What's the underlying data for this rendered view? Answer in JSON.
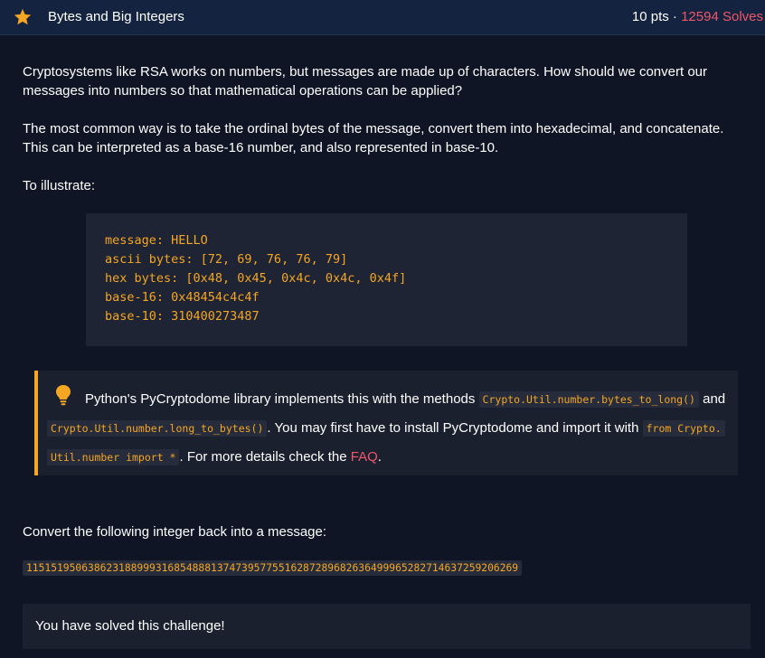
{
  "header": {
    "title": "Bytes and Big Integers",
    "points": "10 pts",
    "separator": " · ",
    "solves": "12594 Solves",
    "star_color": "#f5a623"
  },
  "body": {
    "para1": "Cryptosystems like RSA works on numbers, but messages are made up of characters. How should we convert our messages into numbers so that mathematical operations can be applied?",
    "para2": "The most common way is to take the ordinal bytes of the message, convert them into hexadecimal, and concatenate. This can be interpreted as a base-16 number, and also represented in base-10.",
    "para3": "To illustrate:",
    "code_lines": [
      "message: HELLO",
      "ascii bytes: [72, 69, 76, 76, 79]",
      "hex bytes: [0x48, 0x45, 0x4c, 0x4c, 0x4f]",
      "base-16: 0x48454c4c4f",
      "base-10: 310400273487"
    ]
  },
  "note": {
    "icon": "lightbulb-icon",
    "t1": "Python's PyCryptodome library implements this with the methods ",
    "c1": "Crypto.Util.number.bytes_to_long()",
    "t2": " and ",
    "c2": "Crypto.Util.number.long_to_bytes()",
    "t3": ". You may first have to install PyCryptodome and import it with ",
    "c3a": "from Crypto.",
    "c3b": "Util.number import *",
    "t4": ". For more details check the ",
    "link": "FAQ",
    "t5": "."
  },
  "task": {
    "prompt": "Convert the following integer back into a message:",
    "integer": "11515195063862318899931685488813747395775516287289682636499965282714637259206269"
  },
  "status": {
    "solved_text": "You have solved this challenge!"
  },
  "colors": {
    "accent": "#f5a623",
    "solves": "#ef5769",
    "header_bg": "#14233f",
    "page_bg": "#0f1524"
  }
}
